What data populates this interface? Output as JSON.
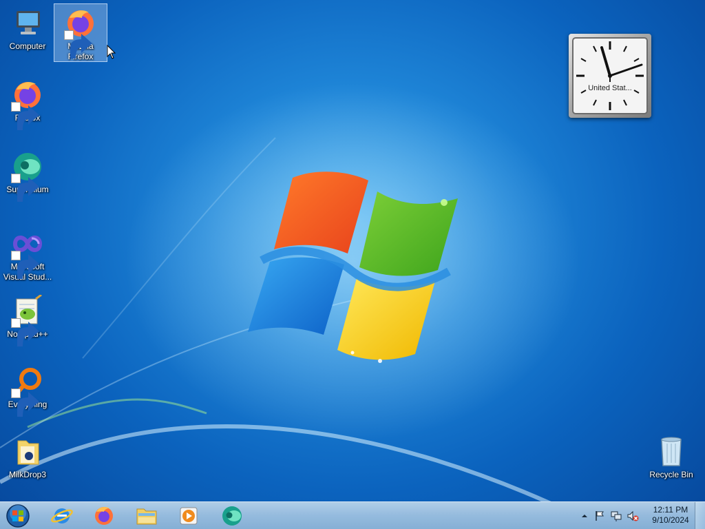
{
  "desktop": {
    "icons": [
      {
        "label": "Computer",
        "icon": "computer-icon"
      },
      {
        "label": "Mozilla Firefox",
        "icon": "firefox-icon",
        "selected": true
      },
      {
        "label": "Firefox",
        "icon": "firefox-icon"
      },
      {
        "label": "Supermium",
        "icon": "supermium-icon"
      },
      {
        "label": "Microsoft Visual Stud...",
        "icon": "visual-studio-icon"
      },
      {
        "label": "Notepad++",
        "icon": "notepad-plus-plus-icon"
      },
      {
        "label": "Everything",
        "icon": "everything-search-icon"
      },
      {
        "label": "MilkDrop3",
        "icon": "folder-icon"
      },
      {
        "label": "Recycle Bin",
        "icon": "recycle-bin-icon"
      }
    ]
  },
  "clock_gadget": {
    "city": "United Stat...",
    "time_shown": "12:11"
  },
  "taskbar": {
    "start_icon": "windows-start-orb-icon",
    "pinned": [
      {
        "name": "Internet Explorer",
        "icon": "internet-explorer-icon"
      },
      {
        "name": "Firefox",
        "icon": "firefox-icon"
      },
      {
        "name": "Windows Explorer",
        "icon": "file-explorer-icon"
      },
      {
        "name": "Windows Media Player",
        "icon": "media-player-icon"
      },
      {
        "name": "Supermium",
        "icon": "supermium-icon"
      }
    ],
    "tray": {
      "time": "12:11 PM",
      "date": "9/10/2024",
      "icons": [
        "show-hidden-icons-icon",
        "action-center-flag-icon",
        "network-icon",
        "volume-muted-icon"
      ]
    }
  },
  "colors": {
    "wallpaper_blue": "#1f86d8",
    "taskbar": "#a9c7e3",
    "firefox_orange": "#ff7139",
    "firefox_purple": "#7542e5"
  }
}
